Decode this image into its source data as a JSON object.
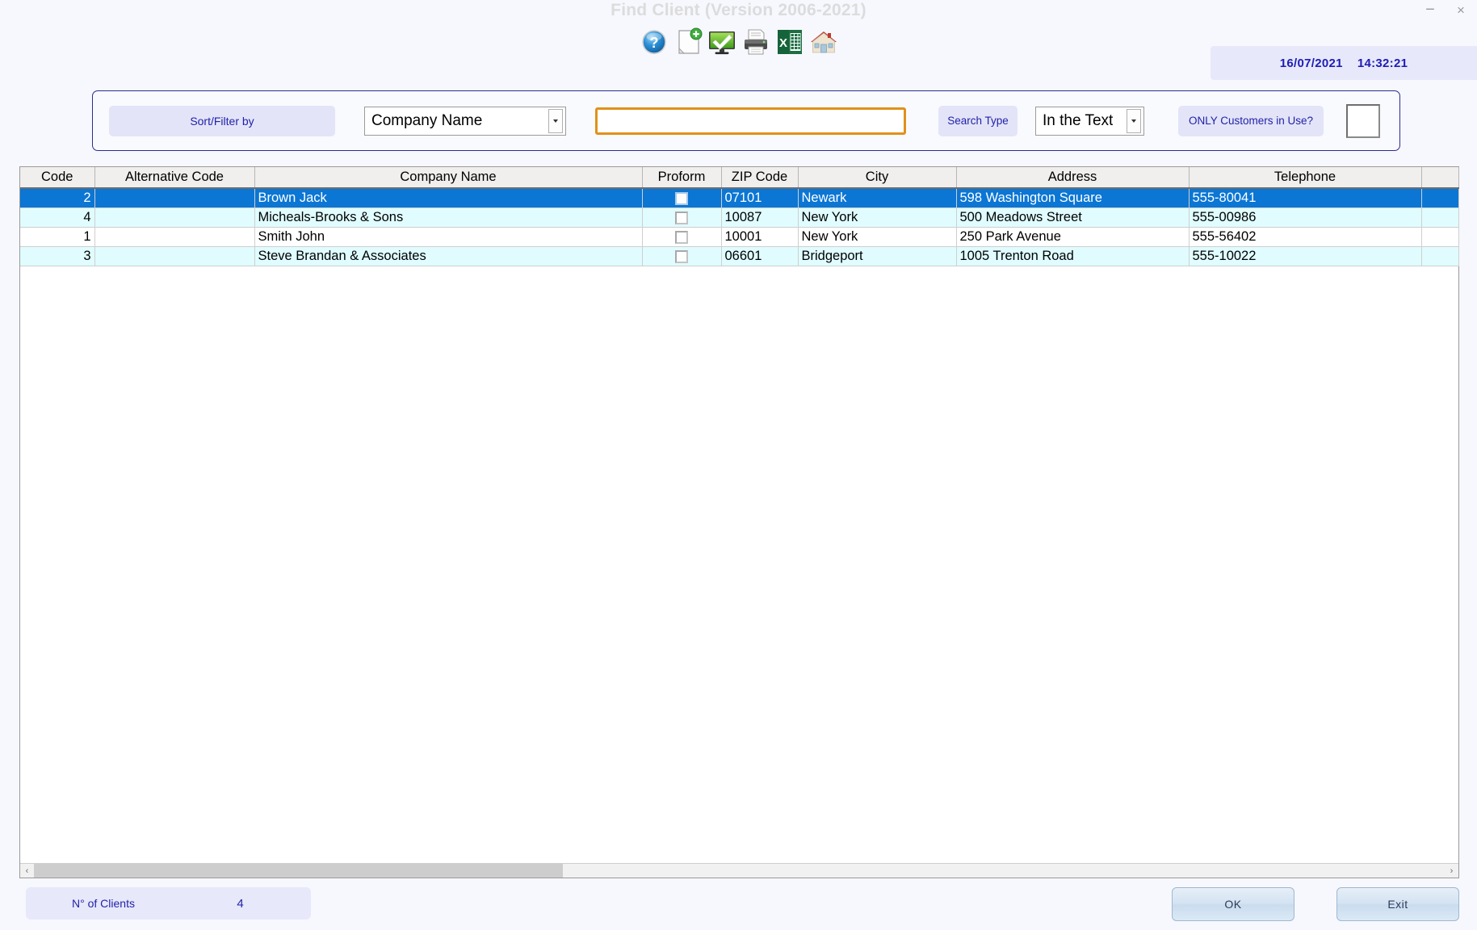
{
  "window": {
    "title": "Find Client (Version 2006-2021)",
    "minimize_label": "−",
    "close_label": "×"
  },
  "toolbar": {
    "icons": [
      {
        "name": "help-icon",
        "title": "Help"
      },
      {
        "name": "new-document-icon",
        "title": "New"
      },
      {
        "name": "monitor-check-icon",
        "title": "Select / Confirm"
      },
      {
        "name": "print-icon",
        "title": "Print"
      },
      {
        "name": "excel-export-icon",
        "title": "Export to Excel"
      },
      {
        "name": "home-icon",
        "title": "Home"
      }
    ]
  },
  "datetime": {
    "date": "16/07/2021",
    "time": "14:32:21"
  },
  "filterbar": {
    "sort_filter_label": "Sort/Filter by",
    "sort_field_value": "Company Name",
    "search_value": "",
    "search_placeholder": "",
    "search_type_label": "Search Type",
    "search_type_value": "In the Text",
    "only_in_use_label": "ONLY Customers in Use?",
    "only_in_use_checked": false,
    "accent_border": "#e0911a"
  },
  "grid": {
    "columns": [
      "Code",
      "Alternative Code",
      "Company Name",
      "Proform",
      "ZIP Code",
      "City",
      "Address",
      "Telephone",
      ""
    ],
    "rows": [
      {
        "code": "2",
        "alt_code": "",
        "company": "Brown Jack",
        "proform": false,
        "zip": "07101",
        "city": "Newark",
        "address": "598 Washington Square",
        "telephone": "555-80041",
        "extra": "",
        "selected": true
      },
      {
        "code": "4",
        "alt_code": "",
        "company": "Micheals-Brooks & Sons",
        "proform": false,
        "zip": "10087",
        "city": "New York",
        "address": "500 Meadows Street",
        "telephone": "555-00986",
        "extra": "",
        "selected": false
      },
      {
        "code": "1",
        "alt_code": "",
        "company": "Smith John",
        "proform": false,
        "zip": "10001",
        "city": "New York",
        "address": "250 Park Avenue",
        "telephone": "555-56402",
        "extra": "",
        "selected": false
      },
      {
        "code": "3",
        "alt_code": "",
        "company": "Steve Brandan & Associates",
        "proform": false,
        "zip": "06601",
        "city": "Bridgeport",
        "address": "1005 Trenton Road",
        "telephone": "555-10022",
        "extra": "",
        "selected": false
      }
    ],
    "selection_color": "#0b76d4",
    "alt_row_color": "#e0fcff",
    "scroll_left_arrow": "‹",
    "scroll_right_arrow": "›"
  },
  "bottom": {
    "clients_label": "N° of Clients",
    "clients_count": "4",
    "ok_label": "OK",
    "exit_label": "Exit"
  }
}
